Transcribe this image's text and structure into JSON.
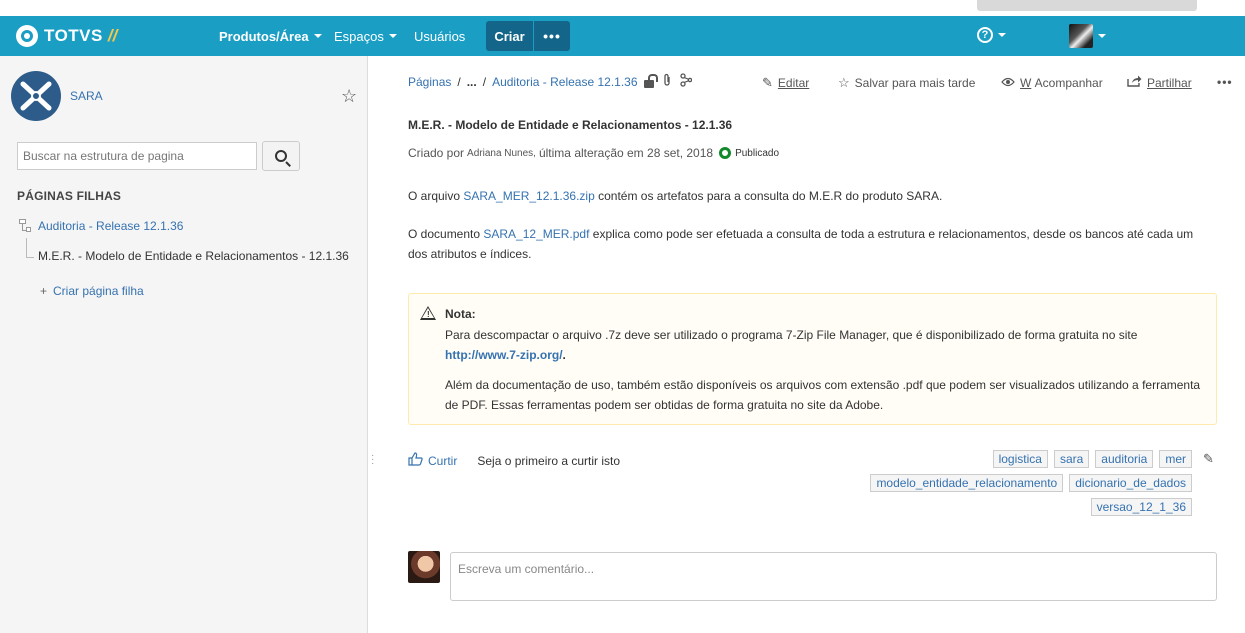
{
  "header": {
    "brand": "TOTVS",
    "brand_slashes": "//",
    "nav": {
      "produtos": "Produtos/Área",
      "espacos": "Espaços",
      "usuarios": "Usuários"
    },
    "create_label": "Criar",
    "more_label": "•••",
    "help_label": "?"
  },
  "sidebar": {
    "space_name": "SARA",
    "search_placeholder": "Buscar na estrutura de pagina",
    "child_pages_heading": "PÁGINAS FILHAS",
    "tree": [
      {
        "label": "Auditoria - Release 12.1.36"
      },
      {
        "label": "M.E.R. - Modelo de Entidade e Relacionamentos - 12.1.36"
      }
    ],
    "add_child_label": "Criar página filha"
  },
  "breadcrumb": {
    "root": "Páginas",
    "ellipsis": "...",
    "current": "Auditoria - Release 12.1.36"
  },
  "actions": {
    "edit": "Editar",
    "save_later": "Salvar para mais tarde",
    "watch": "Acompanhar",
    "watch_prefix": "W",
    "share": "Partilhar"
  },
  "page": {
    "title": "M.E.R. - Modelo de Entidade e Relacionamentos - 12.1.36",
    "meta_created": "Criado por",
    "meta_author": "Adriana Nunes,",
    "meta_modified": "última alteração em 28 set, 2018",
    "meta_status": "Publicado",
    "p1_before": "O arquivo ",
    "p1_link": "SARA_MER_12.1.36.zip",
    "p1_after": " contém os artefatos para a consulta do M.E.R do produto SARA.",
    "p2_before": "O documento ",
    "p2_link": "SARA_12_MER.pdf",
    "p2_after": " explica como pode ser efetuada a consulta de toda a estrutura e relacionamentos, desde os bancos até cada um dos atributos e índices."
  },
  "note": {
    "title": "Nota:",
    "line1_before": "Para descompactar o arquivo .7z deve ser utilizado o programa 7-Zip File Manager, que é disponibilizado de forma gratuita no site ",
    "line1_link": "http://www.7-zip.org/",
    "line1_after": ".",
    "line2": "Além da documentação de uso, também estão disponíveis os arquivos com extensão .pdf que podem ser visualizados utilizando a ferramenta de PDF. Essas ferramentas podem ser obtidas de forma gratuita no site da Adobe."
  },
  "like": {
    "button": "Curtir",
    "text": "Seja o primeiro a curtir isto"
  },
  "labels": [
    "logistica",
    "sara",
    "auditoria",
    "mer",
    "modelo_entidade_relacionamento",
    "dicionario_de_dados",
    "versao_12_1_36"
  ],
  "comment": {
    "placeholder": "Escreva um comentário..."
  },
  "colors": {
    "header_bg": "#1a9ec3",
    "create_bg": "#13668a",
    "link": "#3572b0",
    "published": "#14892c",
    "note_bg": "#fffdf6",
    "note_border": "#ffeaae"
  }
}
